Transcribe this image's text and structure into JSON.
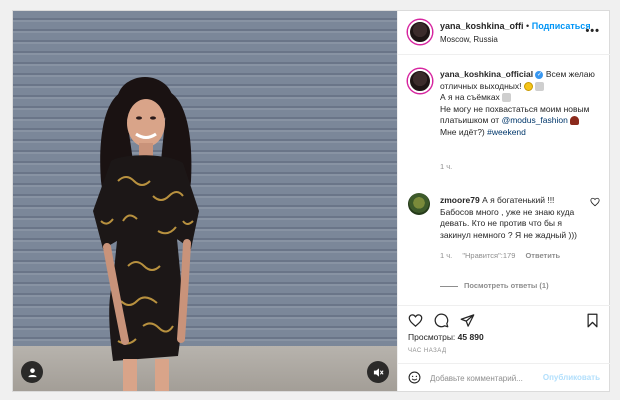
{
  "header": {
    "username": "yana_koshkina_offi",
    "separator": "•",
    "follow_label": "Подписаться",
    "location": "Moscow, Russia",
    "more_label": "•••"
  },
  "caption": {
    "username": "yana_koshkina_official",
    "line1": "Всем желаю отличных выходных!",
    "line2": "А я на съёмках",
    "line3": "Не могу не похвастаться моим новым платьишком от",
    "mention": "@modus_fashion",
    "line4": "Мне идёт?)",
    "hashtag": "#weekend",
    "time": "1 ч."
  },
  "comment": {
    "username": "zmoore79",
    "text": "А я богатенький !!! Бабосов много , уже не знаю куда девать. Кто не против что бы я закинул немного ? Я не жадный )))",
    "time": "1 ч.",
    "likes": "\"Нравится\":179",
    "reply_label": "Ответить",
    "view_replies": "Посмотреть ответы (1)"
  },
  "stats": {
    "views_label": "Просмотры:",
    "views_value": "45 890",
    "ago": "ЧАС НАЗАД"
  },
  "add_comment": {
    "placeholder": "Добавьте комментарий...",
    "publish_label": "Опубликовать"
  },
  "colors": {
    "accent": "#0095f6",
    "verified": "#3897f0",
    "muted": "#8e8e8e"
  }
}
